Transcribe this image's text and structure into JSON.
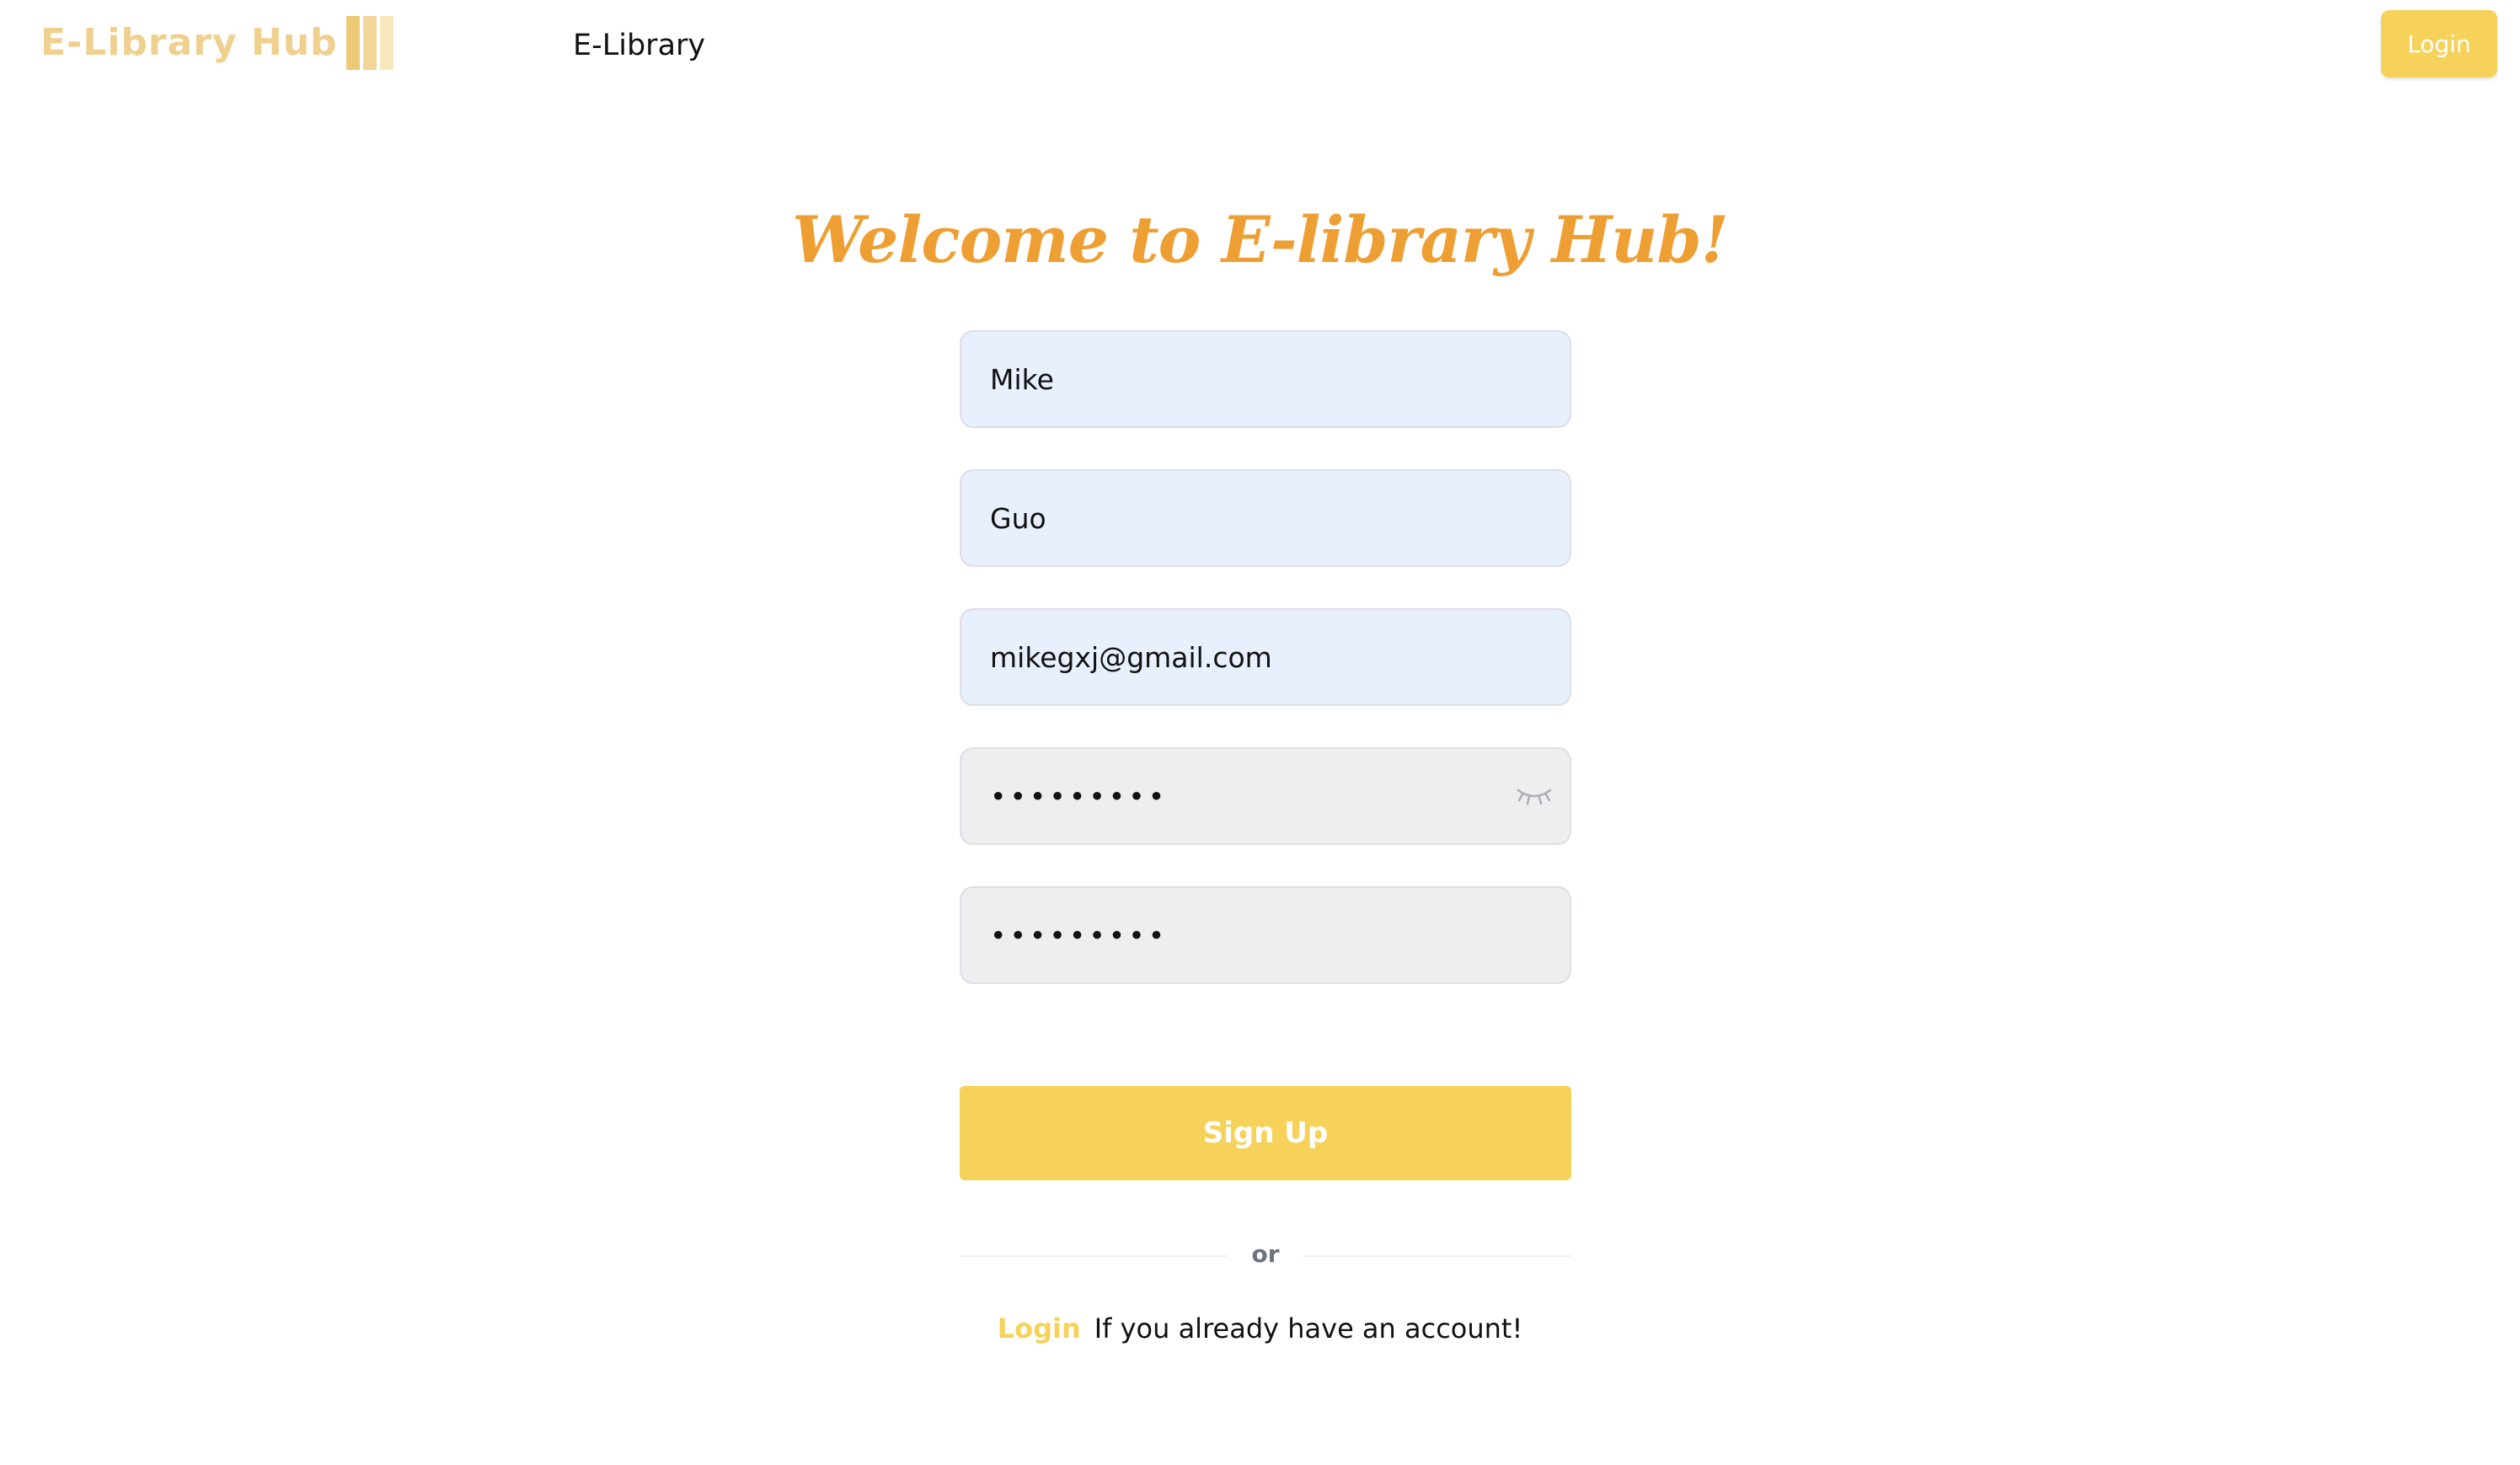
{
  "header": {
    "logo_text": "E-Library Hub",
    "nav_title": "E-Library",
    "login_label": "Login"
  },
  "main": {
    "heading": "Welcome to E-library Hub!",
    "first_name_value": "Mike",
    "last_name_value": "Guo",
    "email_value": "mikegxj@gmail.com",
    "password_value": "•••••••••",
    "confirm_password_value": "•••••••••",
    "signup_label": "Sign Up",
    "divider_text": "or",
    "login_link_label": "Login",
    "login_prompt": "If you already have an account!"
  },
  "icons": {
    "password_toggle": "eye-closed-icon",
    "logo_mark": "bookshelf-icon"
  },
  "colors": {
    "accent": "#f6d25a",
    "heading": "#ee9f33",
    "logo": "#f0d08f",
    "autofill": "#e8effd",
    "password_bg": "#eeeeee"
  }
}
